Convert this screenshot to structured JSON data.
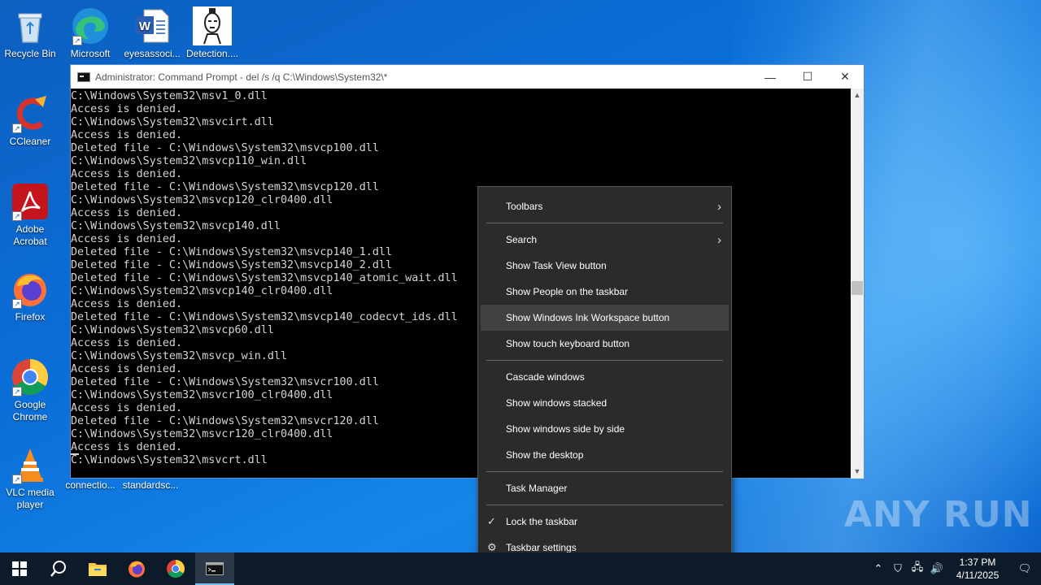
{
  "desktop": {
    "icons": [
      {
        "label": "Recycle Bin"
      },
      {
        "label": "Microsoft Edge"
      },
      {
        "label": "eyesassoci..."
      },
      {
        "label": "Detection...."
      },
      {
        "label": "CCleaner"
      },
      {
        "label": "Adobe Acrobat"
      },
      {
        "label": "Firefox"
      },
      {
        "label": "Google Chrome"
      },
      {
        "label": "VLC media player"
      },
      {
        "label": "connectio..."
      },
      {
        "label": "standardsc..."
      }
    ]
  },
  "cmd": {
    "title": "Administrator: Command Prompt - del  /s /q C:\\Windows\\System32\\*",
    "minimize": "—",
    "maximize": "☐",
    "close": "✕",
    "lines": [
      "C:\\Windows\\System32\\msv1_0.dll",
      "Access is denied.",
      "C:\\Windows\\System32\\msvcirt.dll",
      "Access is denied.",
      "Deleted file - C:\\Windows\\System32\\msvcp100.dll",
      "C:\\Windows\\System32\\msvcp110_win.dll",
      "Access is denied.",
      "Deleted file - C:\\Windows\\System32\\msvcp120.dll",
      "C:\\Windows\\System32\\msvcp120_clr0400.dll",
      "Access is denied.",
      "C:\\Windows\\System32\\msvcp140.dll",
      "Access is denied.",
      "Deleted file - C:\\Windows\\System32\\msvcp140_1.dll",
      "Deleted file - C:\\Windows\\System32\\msvcp140_2.dll",
      "Deleted file - C:\\Windows\\System32\\msvcp140_atomic_wait.dll",
      "C:\\Windows\\System32\\msvcp140_clr0400.dll",
      "Access is denied.",
      "Deleted file - C:\\Windows\\System32\\msvcp140_codecvt_ids.dll",
      "C:\\Windows\\System32\\msvcp60.dll",
      "Access is denied.",
      "C:\\Windows\\System32\\msvcp_win.dll",
      "Access is denied.",
      "Deleted file - C:\\Windows\\System32\\msvcr100.dll",
      "C:\\Windows\\System32\\msvcr100_clr0400.dll",
      "Access is denied.",
      "Deleted file - C:\\Windows\\System32\\msvcr120.dll",
      "C:\\Windows\\System32\\msvcr120_clr0400.dll",
      "Access is denied.",
      "C:\\Windows\\System32\\msvcrt.dll"
    ]
  },
  "context_menu": {
    "toolbars": "Toolbars",
    "search": "Search",
    "task_view": "Show Task View button",
    "people": "Show People on the taskbar",
    "ink": "Show Windows Ink Workspace button",
    "touch_keyboard": "Show touch keyboard button",
    "cascade": "Cascade windows",
    "stacked": "Show windows stacked",
    "side_by_side": "Show windows side by side",
    "desktop": "Show the desktop",
    "task_manager": "Task Manager",
    "lock": "Lock the taskbar",
    "settings": "Taskbar settings"
  },
  "taskbar": {
    "time": "1:37 PM",
    "date": "4/11/2025"
  },
  "watermark": "ANY RUN"
}
